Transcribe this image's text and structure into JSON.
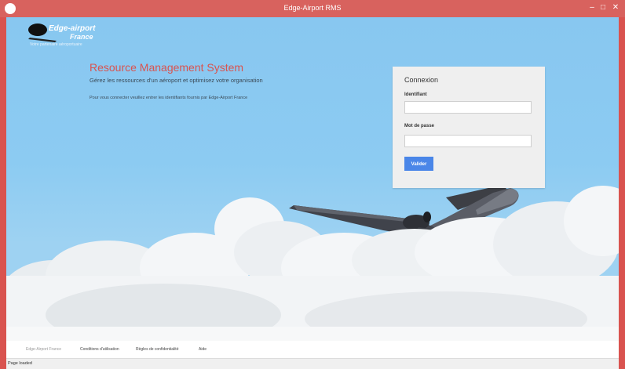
{
  "window": {
    "title": "Edge-Airport RMS",
    "controls": {
      "minimize": "–",
      "maximize": "□",
      "close": "✕"
    }
  },
  "logo": {
    "line1": "Edge-airport",
    "line2": "France",
    "tagline": "Votre partenaire aéroportuaire"
  },
  "hero": {
    "title": "Resource Management System",
    "subtitle": "Gérez les ressources d'un aéroport et optimisez votre organisation",
    "note": "Pour vous connecter veuillez entrer les identifiants fournis par Edge-Airport France"
  },
  "login": {
    "heading": "Connexion",
    "username_label": "Identifiant",
    "username_value": "",
    "password_label": "Mot de passe",
    "password_value": "",
    "submit_label": "Valider"
  },
  "footer": {
    "links": [
      "Edge-Airport France",
      "Conditions d'utilisation",
      "Règles de confidentialité",
      "Aide"
    ]
  },
  "status": {
    "text": "Page loaded"
  },
  "colors": {
    "titlebar": "#d8625e",
    "accent": "#d9534f",
    "sky": "#86c5ee",
    "button": "#4a86e8"
  }
}
